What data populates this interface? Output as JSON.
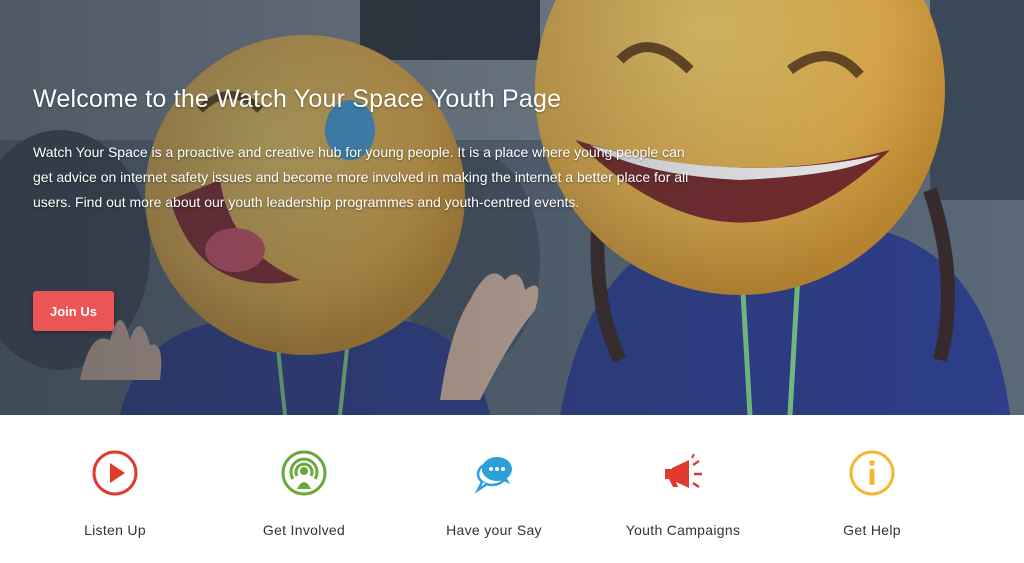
{
  "hero": {
    "title": "Welcome to the Watch Your Space Youth Page",
    "description": "Watch Your Space is a proactive and creative hub for young people. It is a place where young people can get advice on internet safety issues and become more involved in making the internet a better place for all users. Find out more about our youth leadership programmes and youth-centred events.",
    "cta_label": "Join Us",
    "cta_color": "#ec5555"
  },
  "features": [
    {
      "label": "Listen Up",
      "icon": "play-circle-icon",
      "color": "#e03a2f"
    },
    {
      "label": "Get Involved",
      "icon": "podcast-person-icon",
      "color": "#6aaa3a"
    },
    {
      "label": "Have your Say",
      "icon": "chat-bubbles-icon",
      "color": "#2a9fd8"
    },
    {
      "label": "Youth Campaigns",
      "icon": "megaphone-icon",
      "color": "#e03a2f"
    },
    {
      "label": "Get Help",
      "icon": "info-circle-icon",
      "color": "#f5b731"
    }
  ]
}
